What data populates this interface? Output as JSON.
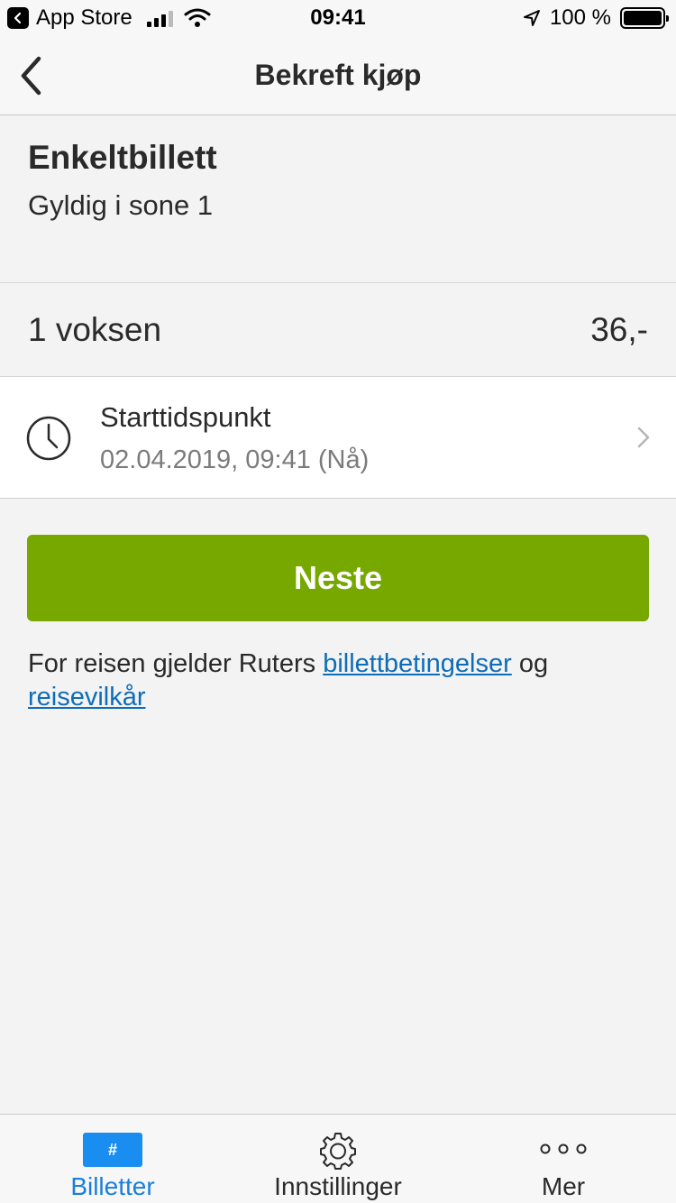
{
  "status_bar": {
    "back_app": "App Store",
    "time": "09:41",
    "battery": "100 %"
  },
  "nav": {
    "title": "Bekreft kjøp"
  },
  "ticket": {
    "name": "Enkeltbillett",
    "zone": "Gyldig i sone 1"
  },
  "passenger": {
    "label": "1 voksen",
    "price": "36,-"
  },
  "start_time": {
    "label": "Starttidspunkt",
    "value": "02.04.2019, 09:41 (Nå)"
  },
  "next_button": {
    "label": "Neste"
  },
  "terms": {
    "prefix": "For reisen gjelder Ruters",
    "link1": "billettbetingelser",
    "middle": "og",
    "link2": "reisevilkår"
  },
  "tab_bar": {
    "tabs": [
      {
        "label": "Billetter",
        "icon": "ticket-icon",
        "badge": "#"
      },
      {
        "label": "Innstillinger",
        "icon": "gear-icon"
      },
      {
        "label": "Mer",
        "icon": "more-dots-icon"
      }
    ]
  },
  "colors": {
    "accent_green": "#76a800",
    "link_blue": "#0e6db8",
    "tab_active": "#1a7fdb"
  }
}
